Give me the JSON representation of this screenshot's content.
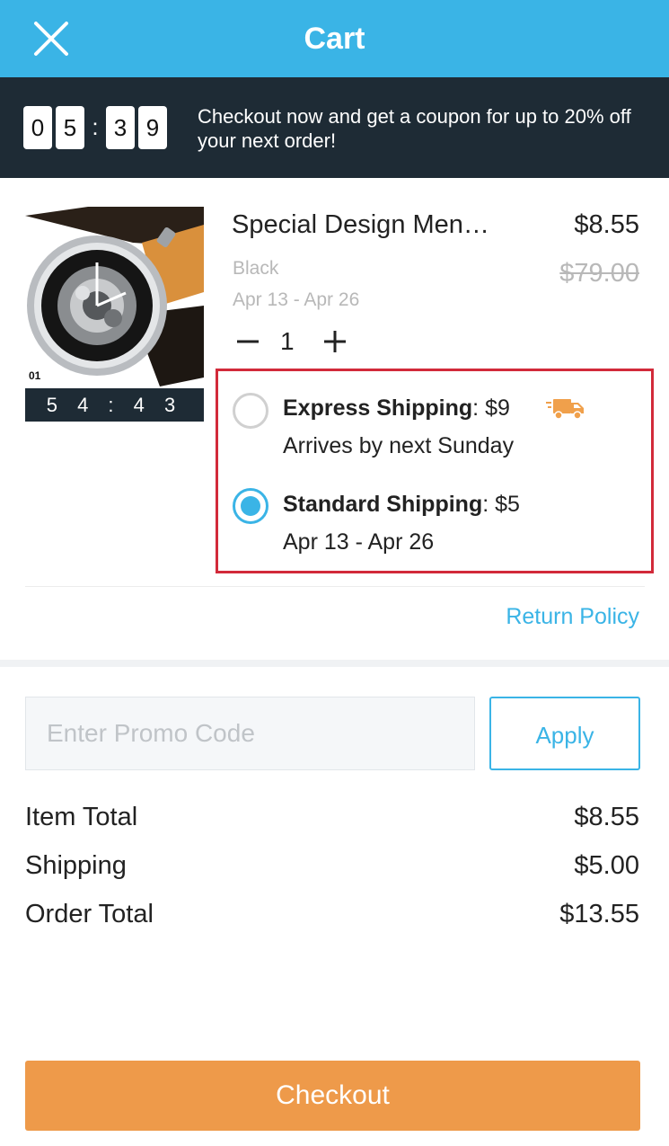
{
  "header": {
    "title": "Cart",
    "close_icon": "close-icon"
  },
  "promo_banner": {
    "timer_digits": [
      "0",
      "5",
      "3",
      "9"
    ],
    "timer_separator": ":",
    "message": "Checkout now and get a coupon for up to 20% off your next order!"
  },
  "product": {
    "name": "Special Design Men…",
    "price": "$8.55",
    "original_price": "$79.00",
    "variant": "Black",
    "delivery_dates": "Apr 13 - Apr 26",
    "quantity": "1",
    "image_label": "01",
    "image_timer": "5 4 : 4 3"
  },
  "shipping": {
    "options": [
      {
        "name": "Express Shipping",
        "price": ": $9",
        "detail": "Arrives by next Sunday",
        "selected": false,
        "icon": "truck-icon"
      },
      {
        "name": "Standard Shipping",
        "price": ": $5",
        "detail": "Apr 13 - Apr 26",
        "selected": true
      }
    ]
  },
  "return_policy": "Return Policy",
  "promo_code": {
    "placeholder": "Enter Promo Code",
    "value": "",
    "apply_label": "Apply"
  },
  "summary": {
    "item_total_label": "Item Total",
    "item_total_value": "$8.55",
    "shipping_label": "Shipping",
    "shipping_value": "$5.00",
    "order_total_label": "Order Total",
    "order_total_value": "$13.55"
  },
  "checkout_label": "Checkout",
  "colors": {
    "header": "#3ab4e6",
    "banner": "#1e2b35",
    "accent": "#3ab4e6",
    "checkout": "#ee9a4a",
    "highlight_box": "#d22a3a",
    "truck": "#f0a04b"
  }
}
